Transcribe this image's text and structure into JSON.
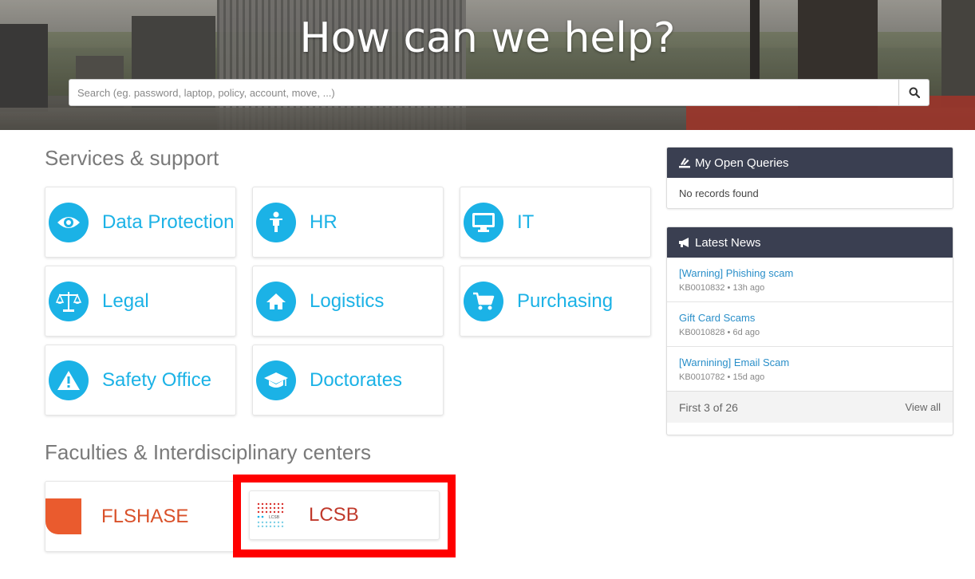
{
  "hero": {
    "title": "How can we help?",
    "search_placeholder": "Search (eg. password, laptop, policy, account, move, ...)",
    "search_icon": "search-icon"
  },
  "services": {
    "title": "Services & support",
    "tiles": [
      {
        "label": "Data Protection",
        "icon": "eye-icon"
      },
      {
        "label": "HR",
        "icon": "person-icon"
      },
      {
        "label": "IT",
        "icon": "monitor-icon"
      },
      {
        "label": "Legal",
        "icon": "scales-icon"
      },
      {
        "label": "Logistics",
        "icon": "home-icon"
      },
      {
        "label": "Purchasing",
        "icon": "cart-icon"
      },
      {
        "label": "Safety Office",
        "icon": "warning-icon"
      },
      {
        "label": "Doctorates",
        "icon": "graduation-cap-icon"
      }
    ]
  },
  "faculties": {
    "title": "Faculties & Interdisciplinary centers",
    "tiles": [
      {
        "label": "FLSHASE",
        "icon": "flshase-logo"
      },
      {
        "label": "LCSB",
        "icon": "lcsb-logo",
        "logo_text": "LCSB"
      }
    ]
  },
  "open_queries": {
    "title": "My Open Queries",
    "empty_text": "No records found"
  },
  "latest_news": {
    "title": "Latest News",
    "items": [
      {
        "title": "[Warning] Phishing scam",
        "meta": "KB0010832 • 13h ago"
      },
      {
        "title": "Gift Card Scams",
        "meta": "KB0010828 • 6d ago"
      },
      {
        "title": "[Warnining] Email Scam",
        "meta": "KB0010782 • 15d ago"
      }
    ],
    "footer_count": "First 3 of 26",
    "view_all": "View all"
  },
  "colors": {
    "accent": "#1bb2e6",
    "panel_header": "#3a3f51",
    "link": "#2a8fc9",
    "highlight": "#ff0000"
  }
}
